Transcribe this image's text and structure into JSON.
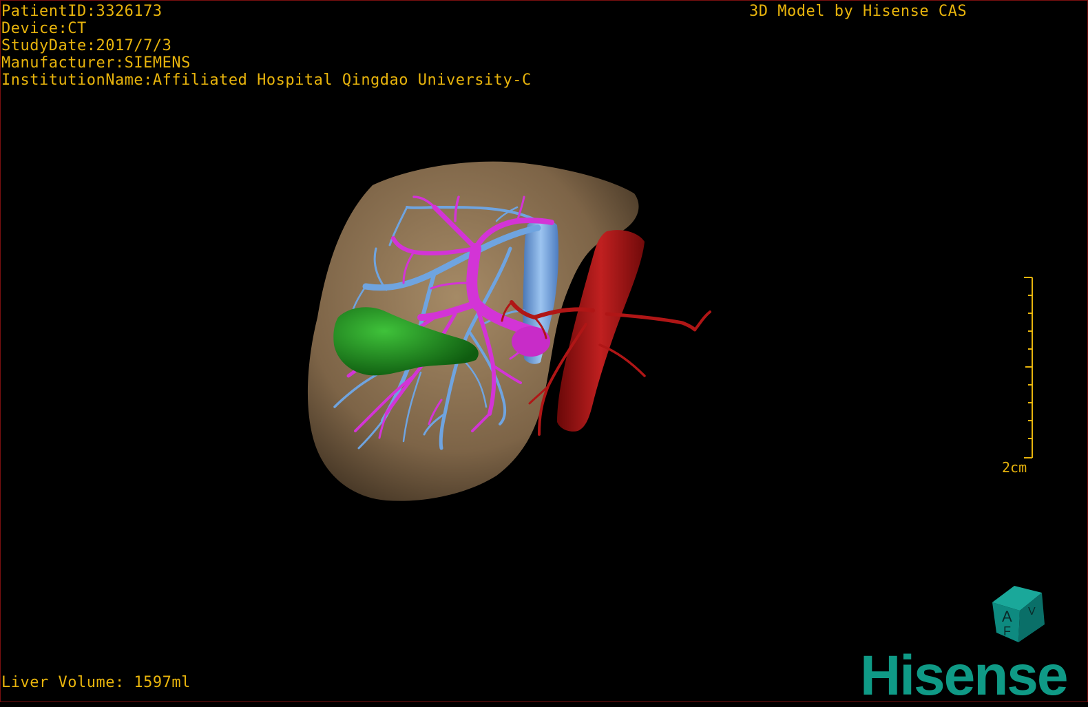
{
  "overlay": {
    "patient_id": "PatientID:3326173",
    "device": "Device:CT",
    "study_date": "StudyDate:2017/7/3",
    "manufacturer": "Manufacturer:SIEMENS",
    "institution": "InstitutionName:Affiliated Hospital Qingdao University-C",
    "model_credit": "3D Model by Hisense CAS",
    "liver_volume": "Liver Volume: 1597ml"
  },
  "scale_bar": {
    "label": "2cm"
  },
  "orientation_cube": {
    "face_labels": [
      "A",
      "F",
      "V"
    ],
    "color": "#0e8a80"
  },
  "brand": {
    "logo_text": "Hisense",
    "color": "#0f9a86"
  },
  "colors": {
    "text": "#e8b40c",
    "liver": "#8c7352",
    "portal_vein": "#d334d6",
    "hepatic_vein": "#6fa4e0",
    "ivc": "#78a8e8",
    "artery": "#b01616",
    "aorta": "#a01010",
    "tumor": "#1f8f1c",
    "frame": "#7a1010"
  }
}
